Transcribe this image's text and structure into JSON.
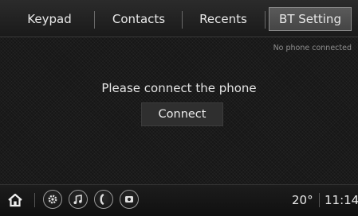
{
  "tabs": [
    {
      "label": "Keypad",
      "active": false
    },
    {
      "label": "Contacts",
      "active": false
    },
    {
      "label": "Recents",
      "active": false
    },
    {
      "label": "BT Setting",
      "active": true
    }
  ],
  "status_message": "No phone connected",
  "prompt": "Please connect the phone",
  "connect_label": "Connect",
  "bottom_bar": {
    "icons": [
      "home-icon",
      "settings-icon",
      "music-icon",
      "phone-icon",
      "camera-icon"
    ],
    "temperature": "20°",
    "clock": "11:14"
  },
  "colors": {
    "background": "#161616",
    "active_tab": "#4f4f4f",
    "text": "#e6e6e6"
  }
}
